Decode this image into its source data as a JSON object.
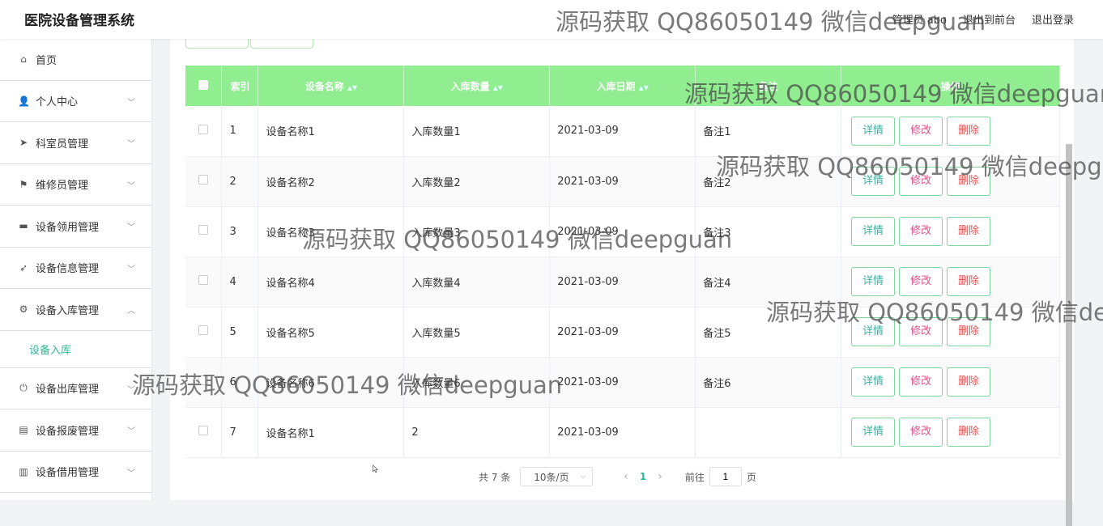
{
  "header": {
    "title": "医院设备管理系统",
    "user": "管理员 abo",
    "back_frontend": "退出到前台",
    "logout": "退出登录"
  },
  "sidebar": {
    "items": [
      {
        "label": "首页",
        "icon": "home-icon",
        "glyph": "⌂"
      },
      {
        "label": "个人中心",
        "icon": "user-icon",
        "glyph": "👤"
      },
      {
        "label": "科室员管理",
        "icon": "send-icon",
        "glyph": "➤"
      },
      {
        "label": "维修员管理",
        "icon": "flag-icon",
        "glyph": "⚑"
      },
      {
        "label": "设备领用管理",
        "icon": "cup-icon",
        "glyph": "▬"
      },
      {
        "label": "设备信息管理",
        "icon": "arrow-icon",
        "glyph": "➶"
      },
      {
        "label": "设备入库管理",
        "icon": "gear-icon",
        "glyph": "⚙"
      },
      {
        "label": "设备出库管理",
        "icon": "power-icon",
        "glyph": "⏻"
      },
      {
        "label": "设备报废管理",
        "icon": "card-icon",
        "glyph": "▤"
      },
      {
        "label": "设备借用管理",
        "icon": "clipboard-icon",
        "glyph": "▥"
      }
    ],
    "sub_active": "设备入库"
  },
  "table": {
    "headers": [
      "索引",
      "设备名称",
      "入库数量",
      "入库日期",
      "备注",
      "操作"
    ],
    "rows": [
      {
        "idx": "1",
        "name": "设备名称1",
        "qty": "入库数量1",
        "date": "2021-03-09",
        "note": "备注1"
      },
      {
        "idx": "2",
        "name": "设备名称2",
        "qty": "入库数量2",
        "date": "2021-03-09",
        "note": "备注2"
      },
      {
        "idx": "3",
        "name": "设备名称3",
        "qty": "入库数量3",
        "date": "2021-03-09",
        "note": "备注3"
      },
      {
        "idx": "4",
        "name": "设备名称4",
        "qty": "入库数量4",
        "date": "2021-03-09",
        "note": "备注4"
      },
      {
        "idx": "5",
        "name": "设备名称5",
        "qty": "入库数量5",
        "date": "2021-03-09",
        "note": "备注5"
      },
      {
        "idx": "6",
        "name": "设备名称6",
        "qty": "入库数量6",
        "date": "2021-03-09",
        "note": "备注6"
      },
      {
        "idx": "7",
        "name": "设备名称1",
        "qty": "2",
        "date": "2021-03-09",
        "note": ""
      }
    ],
    "actions": {
      "detail": "详情",
      "edit": "修改",
      "delete": "删除"
    }
  },
  "pager": {
    "total": "共 7 条",
    "page_size": "10条/页",
    "current": "1",
    "goto_label": "前往",
    "goto_value": "1",
    "page_suffix": "页"
  },
  "watermark": "源码获取 QQ86050149 微信deepguan"
}
